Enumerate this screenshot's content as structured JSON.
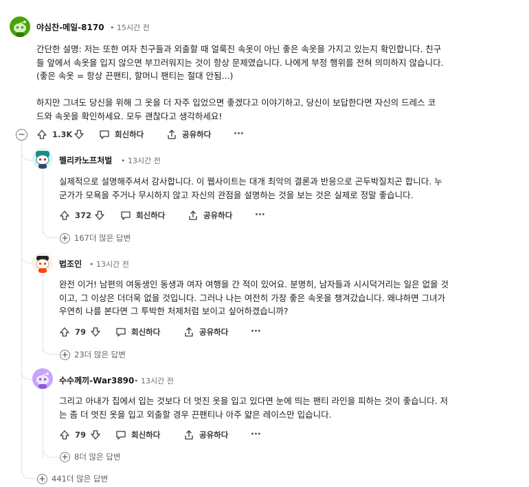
{
  "comments": [
    {
      "username": "야심찬-메일-8170",
      "time": "• 15시간 전",
      "body": [
        "간단한 설명: 저는 또한 여자 친구들과 외출할 때 얼룩진 속옷이 아닌 좋은 속옷을 가지고 있는지 확인합니다. 친구",
        "들 앞에서 속옷을 입지 않으면 부끄러워지는 것이 항상 문제였습니다. 나에게 부정 행위를 전혀 의미하지 않습니다.",
        "(좋은 속옷 = 항상 끈팬티, 할머니 팬티는 절대 안됨...)",
        "",
        " 하지만 그녀도 당신을 위해 그 옷을 더 자주 입었으면 좋겠다고 이야기하고, 당신이 보답한다면 자신의 드레스 코",
        "드와 속옷을 확인하세요. 모두 괜찮다고 생각하세요!"
      ],
      "votes": "1.3K",
      "reply_label": "회신하다",
      "share_label": "공유하다",
      "more_label": "···",
      "avatar_color": "#46a508"
    },
    {
      "username": "펠리카노프처벌",
      "time": "• 13시간 전",
      "body": [
        "실제적으로 설명해주셔서 감사합니다. 이 웹사이트는 대개 최악의 결론과 반응으로 곤두박질치곤 합니다. 누",
        "군가가 모욕을 주거나 무시하지 않고 자신의 관점을 설명하는 것을 보는 것은 실제로 정말 좋습니다."
      ],
      "votes": "372",
      "reply_label": "회신하다",
      "share_label": "공유하다",
      "more_label": "···",
      "more_replies": "167더 많은 답변",
      "avatar_color": "#1a8c8c"
    },
    {
      "username": "법조인",
      "time": "• 13시간 전",
      "body": [
        "완전 이거! 남편의 여동생인 동생과 여자 여행을 간 적이 있어요. 분명히, 남자들과 시시덕거리는 일은 없을 것",
        "이고, 그 이상은 더더욱 없을 것입니다. 그러나 나는 여전히 가장 좋은 속옷을 챙겨갔습니다. 왜냐하면 그녀가",
        "우연히 나를 본다면 그 투박한 처제처럼 보이고 싶어하겠습니까?"
      ],
      "votes": "79",
      "reply_label": "회신하다",
      "share_label": "공유하다",
      "more_label": "···",
      "more_replies": "23더 많은 답변",
      "avatar_color": "#ff4500"
    },
    {
      "username": "수수께끼-War3890",
      "time": "• 13시간 전",
      "body": [
        "그리고 아내가 집에서 입는 것보다 더 멋진 옷을 입고 있다면 눈에 띄는 팬티 라인을 피하는 것이 좋습니다. 저",
        "는 좀 더 멋진 옷을 입고 외출할 경우 끈팬티나 아주 얇은 레이스만 입습니다."
      ],
      "votes": "79",
      "reply_label": "회신하다",
      "share_label": "공유하다",
      "more_label": "···",
      "more_replies": "8더 많은 답변",
      "avatar_color": "#c9a3ff"
    }
  ],
  "thread_more_replies": "441더 많은 답변",
  "collapse_symbol": "−",
  "expand_symbol": "+"
}
